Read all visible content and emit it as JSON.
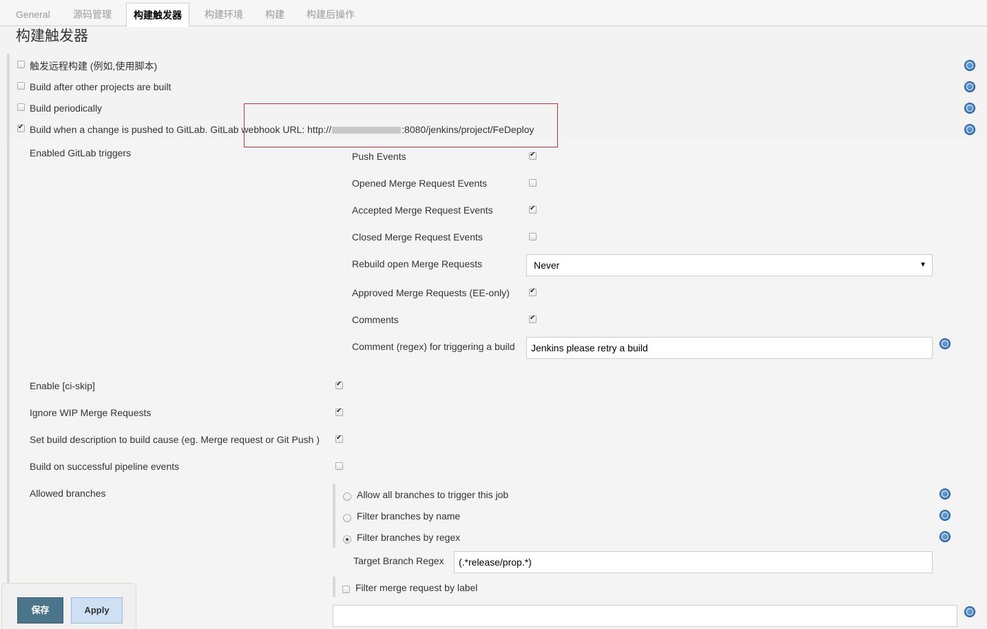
{
  "tabs": [
    {
      "label": "General"
    },
    {
      "label": "源码管理"
    },
    {
      "label": "构建触发器"
    },
    {
      "label": "构建环境"
    },
    {
      "label": "构建"
    },
    {
      "label": "构建后操作"
    }
  ],
  "section_title": "构建触发器",
  "triggers": [
    {
      "label": "触发远程构建 (例如,使用脚本)",
      "checked": false
    },
    {
      "label": "Build after other projects are built",
      "checked": false
    },
    {
      "label": "Build periodically",
      "checked": false
    },
    {
      "label": "Build when a change is pushed to GitLab. GitLab webhook URL: http://",
      "checked": true,
      "url_suffix": ":8080/jenkins/project/FeDeploy"
    }
  ],
  "gitlab": {
    "enabled_triggers_label": "Enabled GitLab triggers",
    "events": [
      {
        "label": "Push Events",
        "checked": true
      },
      {
        "label": "Opened Merge Request Events",
        "checked": false
      },
      {
        "label": "Accepted Merge Request Events",
        "checked": true
      },
      {
        "label": "Closed Merge Request Events",
        "checked": false
      },
      {
        "label": "Rebuild open Merge Requests",
        "value": "Never"
      },
      {
        "label": "Approved Merge Requests (EE-only)",
        "checked": true
      },
      {
        "label": "Comments",
        "checked": true
      },
      {
        "label": "Comment (regex) for triggering a build",
        "value": "Jenkins please retry a build"
      }
    ],
    "options": [
      {
        "label": "Enable [ci-skip]",
        "checked": true
      },
      {
        "label": "Ignore WIP Merge Requests",
        "checked": true
      },
      {
        "label": "Set build description to build cause (eg. Merge request or Git Push )",
        "checked": true
      },
      {
        "label": "Build on successful pipeline events",
        "checked": false
      }
    ],
    "allowed_branches_label": "Allowed branches",
    "branch_options": [
      {
        "label": "Allow all branches to trigger this job",
        "selected": false
      },
      {
        "label": "Filter branches by name",
        "selected": false
      },
      {
        "label": "Filter branches by regex",
        "selected": true
      }
    ],
    "target_branch_regex_label": "Target Branch Regex",
    "target_branch_regex_value": "(.*release/prop.*)",
    "filter_by_label": {
      "label": "Filter merge request by label",
      "checked": false
    }
  },
  "buttons": {
    "save": "保存",
    "apply": "Apply"
  }
}
